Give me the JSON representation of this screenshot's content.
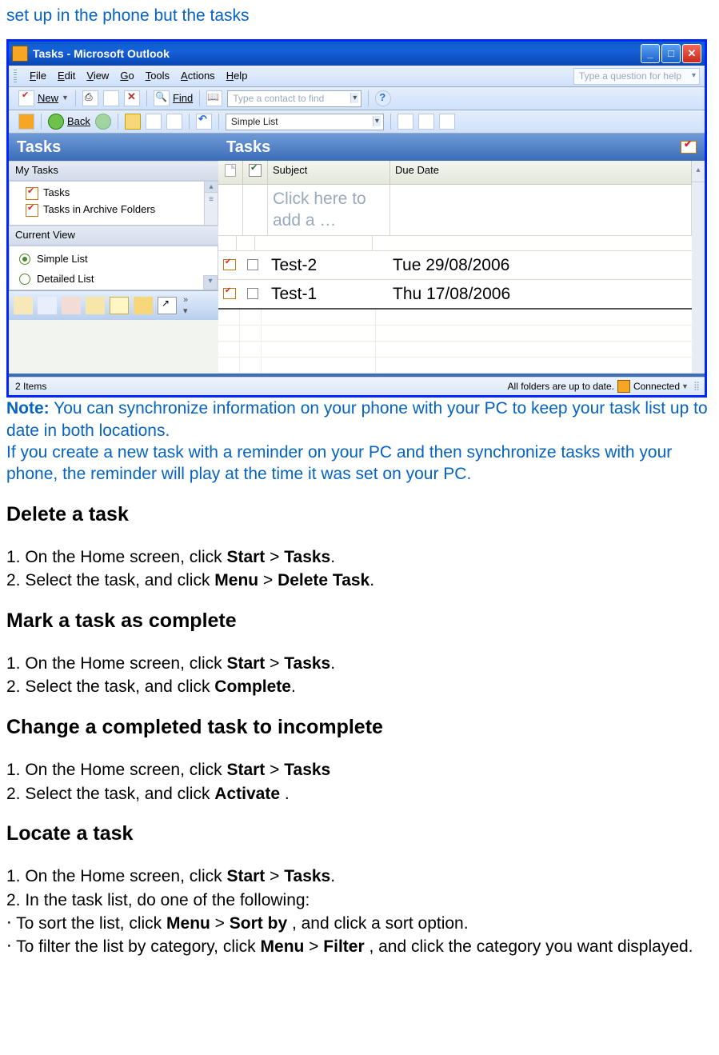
{
  "top_fragment": "set up in the phone but the tasks",
  "outlook": {
    "title": "Tasks - Microsoft Outlook",
    "menu": {
      "file": "File",
      "edit": "Edit",
      "view": "View",
      "go": "Go",
      "tools": "Tools",
      "actions": "Actions",
      "help": "Help"
    },
    "help_placeholder": "Type a question for help",
    "toolbar1": {
      "new_label": "New",
      "find_label": "Find",
      "contact_placeholder": "Type a contact to find"
    },
    "toolbar2": {
      "back_label": "Back",
      "view_combo": "Simple List"
    },
    "left": {
      "header": "Tasks",
      "sub1": "My Tasks",
      "tree": [
        "Tasks",
        "Tasks in Archive Folders"
      ],
      "sub2": "Current View",
      "radios": [
        "Simple List",
        "Detailed List"
      ]
    },
    "right": {
      "header": "Tasks",
      "cols": {
        "subject": "Subject",
        "due": "Due Date"
      },
      "add_placeholder": "Click here to add a …",
      "rows": [
        {
          "subject": "Test-2",
          "due": "Tue 29/08/2006"
        },
        {
          "subject": "Test-1",
          "due": "Thu 17/08/2006"
        }
      ]
    },
    "status": {
      "items": "2 Items",
      "folders": "All folders are up to date.",
      "conn": "Connected"
    }
  },
  "note_label": "Note:",
  "note_text_1": " You can synchronize information on your phone with your PC to keep your task list up to date in both locations.",
  "note_text_2": "If you create a new task with a reminder on your PC and then synchronize tasks with your phone, the reminder will play at the time it was set on your PC.",
  "s_delete": {
    "h": "Delete a task",
    "l1a": "1. On the Home screen, click ",
    "l1b": "Start",
    "l1c": " > ",
    "l1d": "Tasks",
    "l1e": ".",
    "l2a": "2. Select the task, and click ",
    "l2b": "Menu",
    "l2c": " > ",
    "l2d": "Delete Task",
    "l2e": "."
  },
  "s_mark": {
    "h": "Mark a task as complete",
    "l1a": "1. On the Home screen, click ",
    "l1b": "Start",
    "l1c": " > ",
    "l1d": "Tasks",
    "l1e": ".",
    "l2a": "2. Select the task, and click ",
    "l2b": "Complete",
    "l2c": "."
  },
  "s_change": {
    "h": "Change a completed task to incomplete",
    "l1a": "1. On the Home screen, click ",
    "l1b": "Start",
    "l1c": " > ",
    "l1d": "Tasks",
    "l2a": "2. Select the task, and click ",
    "l2b": "Activate",
    "l2c": " ."
  },
  "s_locate": {
    "h": "Locate a task",
    "l1a": "1. On the Home screen, click ",
    "l1b": "Start",
    "l1c": " > ",
    "l1d": "Tasks",
    "l1e": ".",
    "l2": "2. In the task list, do one of the following:",
    "l3a": "‧ To sort the list, click ",
    "l3b": "Menu",
    "l3c": " > ",
    "l3d": "Sort by",
    "l3e": " , and click a sort option.",
    "l4a": "‧ To filter the list by category, click ",
    "l4b": "Menu",
    "l4c": " > ",
    "l4d": "Filter",
    "l4e": " , and click the category you want displayed."
  }
}
